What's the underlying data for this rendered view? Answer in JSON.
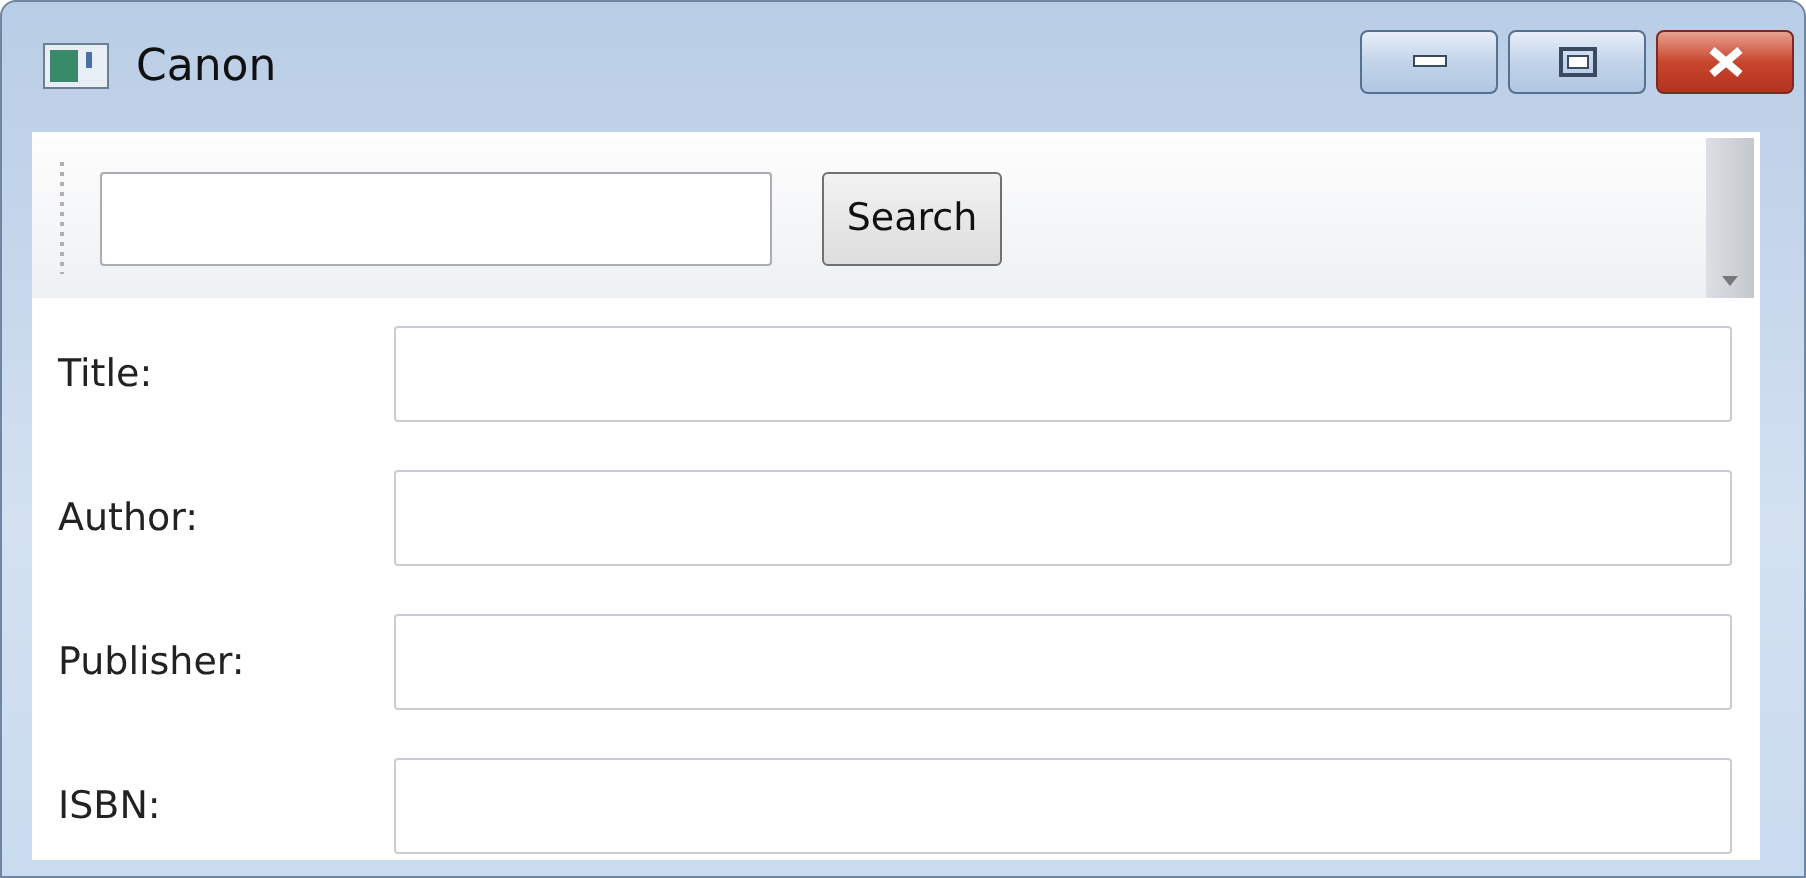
{
  "window": {
    "title": "Canon"
  },
  "toolbar": {
    "button": "Search"
  },
  "form": [
    {
      "label": "Title:"
    },
    {
      "label": "Author:"
    },
    {
      "label": "Publisher:"
    },
    {
      "label": "ISBN:"
    }
  ]
}
